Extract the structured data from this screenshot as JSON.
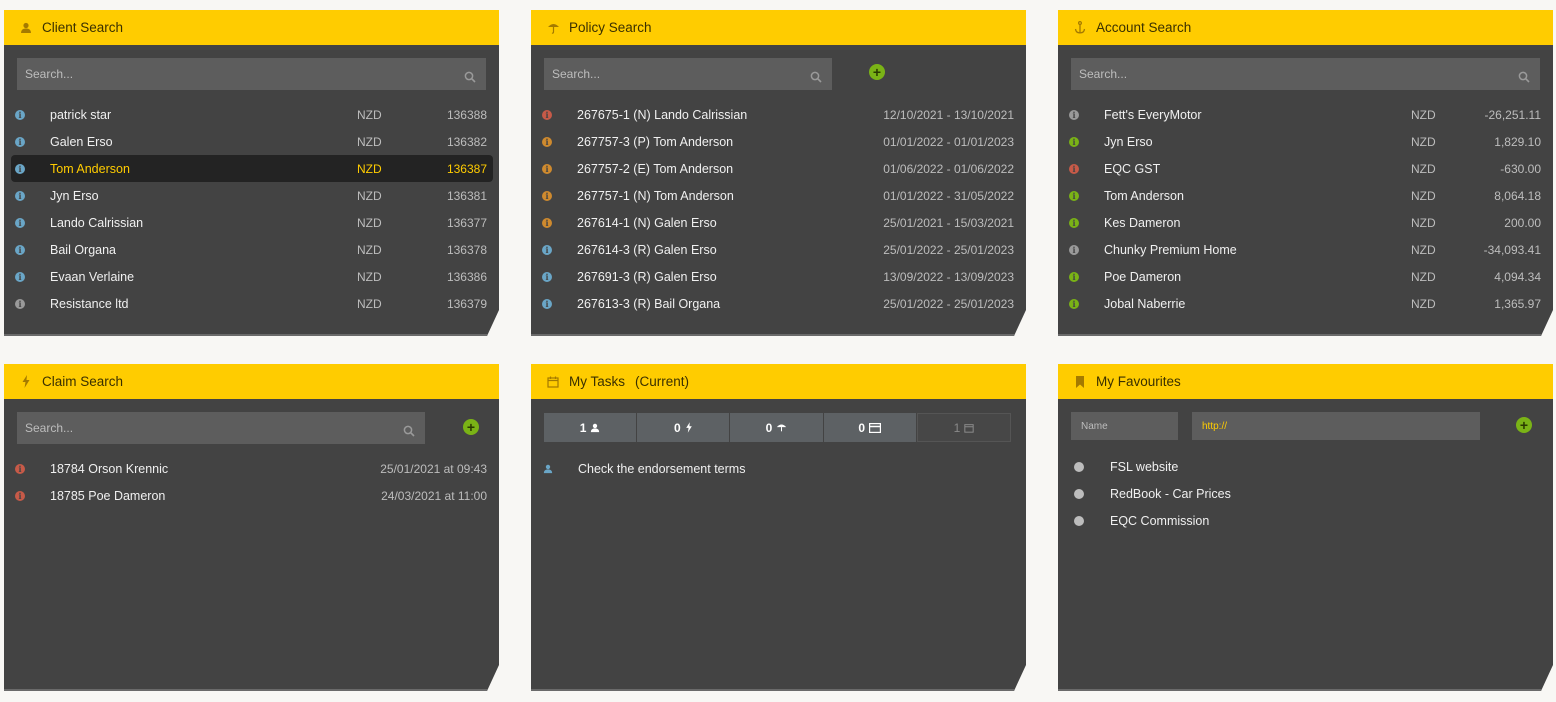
{
  "client_search": {
    "title": "Client Search",
    "search_placeholder": "Search...",
    "rows": [
      {
        "name": "patrick star",
        "currency": "NZD",
        "id": "136388",
        "status": "blue"
      },
      {
        "name": "Galen Erso",
        "currency": "NZD",
        "id": "136382",
        "status": "blue"
      },
      {
        "name": "Tom Anderson",
        "currency": "NZD",
        "id": "136387",
        "status": "blue",
        "selected": true
      },
      {
        "name": "Jyn Erso",
        "currency": "NZD",
        "id": "136381",
        "status": "blue"
      },
      {
        "name": "Lando Calrissian",
        "currency": "NZD",
        "id": "136377",
        "status": "blue"
      },
      {
        "name": "Bail Organa",
        "currency": "NZD",
        "id": "136378",
        "status": "blue"
      },
      {
        "name": "Evaan Verlaine",
        "currency": "NZD",
        "id": "136386",
        "status": "blue"
      },
      {
        "name": "Resistance ltd",
        "currency": "NZD",
        "id": "136379",
        "status": "gray"
      }
    ]
  },
  "policy_search": {
    "title": "Policy Search",
    "search_placeholder": "Search...",
    "rows": [
      {
        "name": "267675-1 (N) Lando Calrissian",
        "dates": "12/10/2021 - 13/10/2021",
        "status": "red"
      },
      {
        "name": "267757-3 (P) Tom Anderson",
        "dates": "01/01/2022 - 01/01/2023",
        "status": "orange"
      },
      {
        "name": "267757-2 (E) Tom Anderson",
        "dates": "01/06/2022 - 01/06/2022",
        "status": "orange"
      },
      {
        "name": "267757-1 (N) Tom Anderson",
        "dates": "01/01/2022 - 31/05/2022",
        "status": "orange"
      },
      {
        "name": "267614-1 (N) Galen Erso",
        "dates": "25/01/2021 - 15/03/2021",
        "status": "orange"
      },
      {
        "name": "267614-3 (R) Galen Erso",
        "dates": "25/01/2022 - 25/01/2023",
        "status": "blue"
      },
      {
        "name": "267691-3 (R) Galen Erso",
        "dates": "13/09/2022 - 13/09/2023",
        "status": "blue"
      },
      {
        "name": "267613-3 (R) Bail Organa",
        "dates": "25/01/2022 - 25/01/2023",
        "status": "blue"
      }
    ]
  },
  "account_search": {
    "title": "Account Search",
    "search_placeholder": "Search...",
    "rows": [
      {
        "name": "Fett's EveryMotor",
        "currency": "NZD",
        "amount": "-26,251.11",
        "status": "gray"
      },
      {
        "name": "Jyn Erso",
        "currency": "NZD",
        "amount": "1,829.10",
        "status": "green"
      },
      {
        "name": "EQC GST",
        "currency": "NZD",
        "amount": "-630.00",
        "status": "red"
      },
      {
        "name": "Tom Anderson",
        "currency": "NZD",
        "amount": "8,064.18",
        "status": "green"
      },
      {
        "name": "Kes Dameron",
        "currency": "NZD",
        "amount": "200.00",
        "status": "green"
      },
      {
        "name": "Chunky Premium Home",
        "currency": "NZD",
        "amount": "-34,093.41",
        "status": "gray"
      },
      {
        "name": "Poe Dameron",
        "currency": "NZD",
        "amount": "4,094.34",
        "status": "green"
      },
      {
        "name": "Jobal Naberrie",
        "currency": "NZD",
        "amount": "1,365.97",
        "status": "green"
      }
    ]
  },
  "claim_search": {
    "title": "Claim Search",
    "search_placeholder": "Search...",
    "rows": [
      {
        "name": "18784 Orson Krennic",
        "datetime": "25/01/2021 at 09:43",
        "status": "red"
      },
      {
        "name": "18785 Poe Dameron",
        "datetime": "24/03/2021 at 11:00",
        "status": "red"
      }
    ]
  },
  "my_tasks": {
    "title": "My Tasks",
    "subtitle": "(Current)",
    "tabs": [
      {
        "count": "1",
        "icon": "user-icon"
      },
      {
        "count": "0",
        "icon": "lightning-icon"
      },
      {
        "count": "0",
        "icon": "umbrella-icon"
      },
      {
        "count": "0",
        "icon": "card-icon"
      },
      {
        "count": "1",
        "icon": "calendar-icon"
      }
    ],
    "tasks": [
      {
        "text": "Check the endorsement terms",
        "icon": "user-icon"
      }
    ]
  },
  "my_favourites": {
    "title": "My Favourites",
    "name_placeholder": "Name",
    "url_value": "http://",
    "items": [
      {
        "label": "FSL website"
      },
      {
        "label": "RedBook - Car Prices"
      },
      {
        "label": "EQC Commission"
      }
    ]
  },
  "colors": {
    "accent": "#ffcc00",
    "panel": "#434343",
    "input": "#5d5d5d",
    "green": "#7ab316",
    "blue": "#6aa6c7",
    "red": "#c75a48",
    "orange": "#cf8a2e"
  }
}
